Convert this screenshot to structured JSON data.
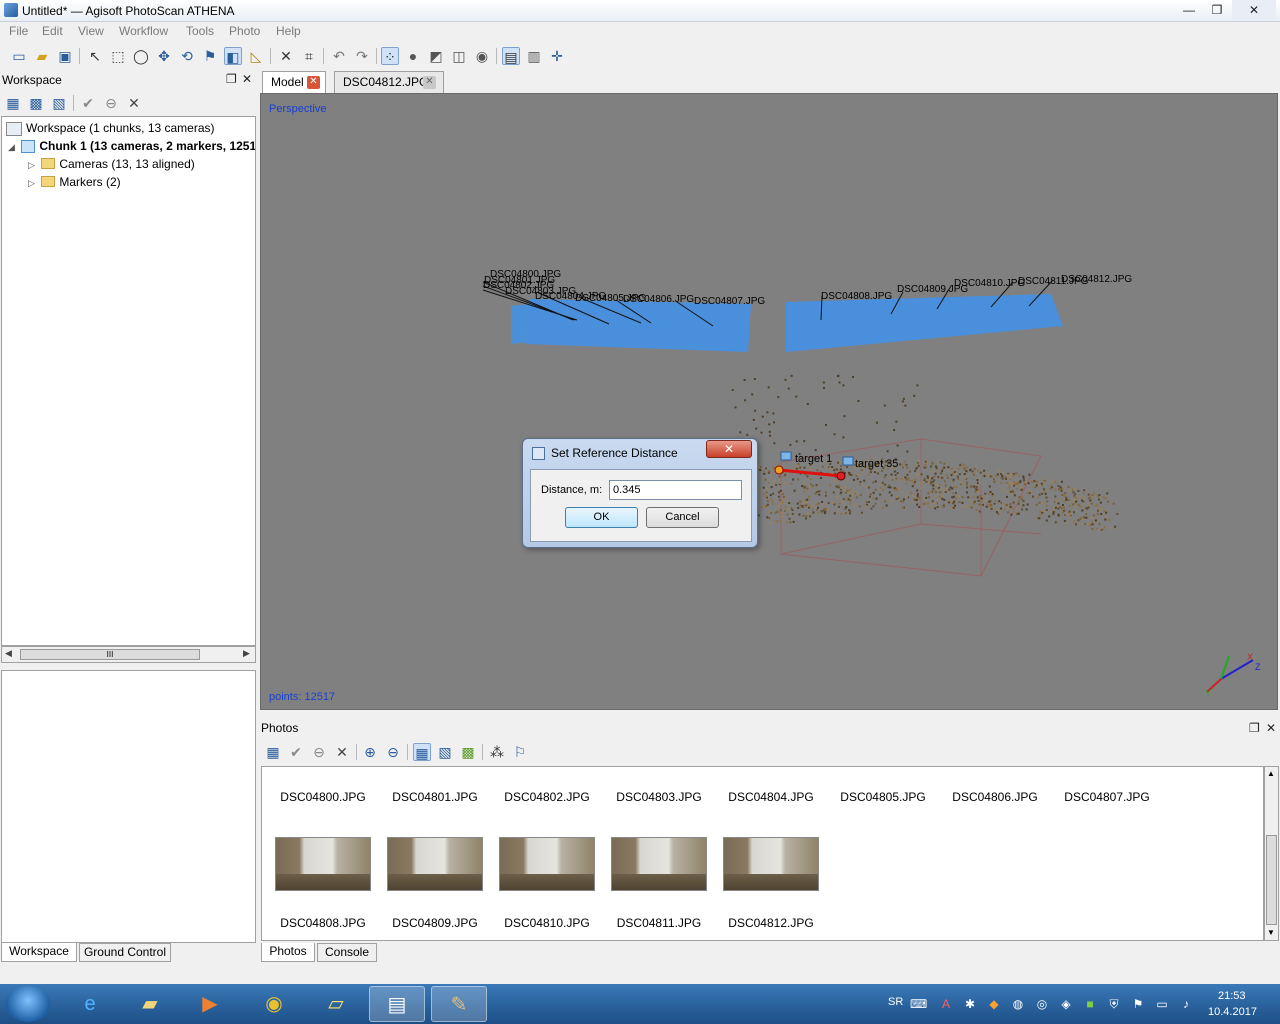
{
  "window": {
    "title": "Untitled* — Agisoft PhotoScan ATHENA",
    "min": "—",
    "max": "❐",
    "close": "✕"
  },
  "menu": [
    "File",
    "Edit",
    "View",
    "Workflow",
    "Tools",
    "Photo",
    "Help"
  ],
  "workspace": {
    "title": "Workspace",
    "root_label": "Workspace (1 chunks, 13 cameras)",
    "chunk_label": "Chunk 1 (13 cameras, 2 markers, 1251",
    "cameras_label": "Cameras (13, 13 aligned)",
    "markers_label": "Markers (2)",
    "scroll_thumb": "III"
  },
  "left_tabs": {
    "workspace": "Workspace",
    "ground_control": "Ground Control"
  },
  "doc_tabs": {
    "model": "Model",
    "photo": "DSC04812.JPG"
  },
  "viewport": {
    "mode": "Perspective",
    "points": "points: 12517",
    "camera_labels": [
      "DSC04800.JPG",
      "DSC04801.JPG",
      "DSC04802.JPG",
      "DSC04803.JPG",
      "DSC04804.JPG",
      "DSC04805.JPG",
      "DSC04806.JPG",
      "DSC04807.JPG",
      "DSC04808.JPG",
      "DSC04809.JPG",
      "DSC04810.JPG",
      "DSC04811.JPG",
      "DSC04812.JPG"
    ],
    "markers": [
      "target 1",
      "target 35"
    ],
    "axes": {
      "x": "X",
      "y": "Y",
      "z": "Z"
    }
  },
  "dialog": {
    "title": "Set Reference Distance",
    "label": "Distance, m:",
    "value": "0.345",
    "ok": "OK",
    "cancel": "Cancel",
    "close": "✕"
  },
  "photos": {
    "title": "Photos",
    "row1": [
      "DSC04800.JPG",
      "DSC04801.JPG",
      "DSC04802.JPG",
      "DSC04803.JPG",
      "DSC04804.JPG",
      "DSC04805.JPG",
      "DSC04806.JPG",
      "DSC04807.JPG"
    ],
    "row2": [
      "DSC04808.JPG",
      "DSC04809.JPG",
      "DSC04810.JPG",
      "DSC04811.JPG",
      "DSC04812.JPG"
    ]
  },
  "bottom_tabs": {
    "photos": "Photos",
    "console": "Console"
  },
  "taskbar": {
    "lang": "SR",
    "time": "21:53",
    "date": "10.4.2017"
  }
}
